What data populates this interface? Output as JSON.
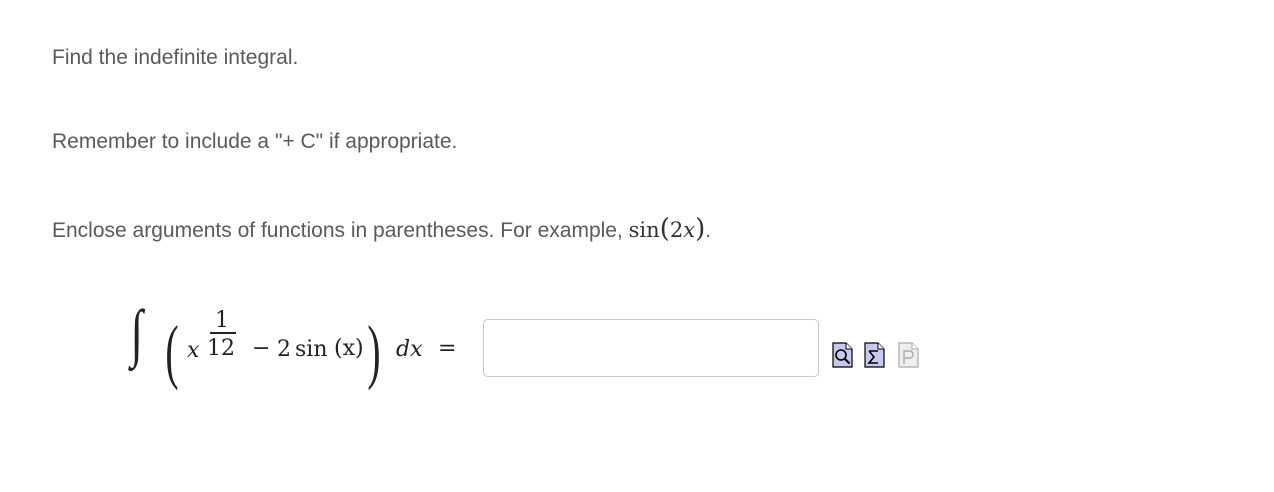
{
  "instructions": {
    "line1": "Find the indefinite integral.",
    "line2": "Remember to include a \"+ C\" if appropriate.",
    "line3_prefix": "Enclose arguments of functions in parentheses. For example,",
    "example_func": "sin",
    "example_open": "(",
    "example_arg_coef": "2",
    "example_arg_var": "x",
    "example_close": ")",
    "line3_suffix": "."
  },
  "problem": {
    "integral_sign": "∫",
    "left_paren": "(",
    "term1_var": "x",
    "exp_numerator": "1",
    "exp_denominator": "12",
    "minus": "−",
    "coef": "2",
    "func": "sin",
    "func_arg": "(x)",
    "right_paren": ")",
    "differential": "dx",
    "equals": "="
  },
  "answer": {
    "value": "",
    "placeholder": ""
  },
  "tools": [
    {
      "name": "preview-icon"
    },
    {
      "name": "equation-editor-icon"
    },
    {
      "name": "plain-text-icon"
    }
  ]
}
